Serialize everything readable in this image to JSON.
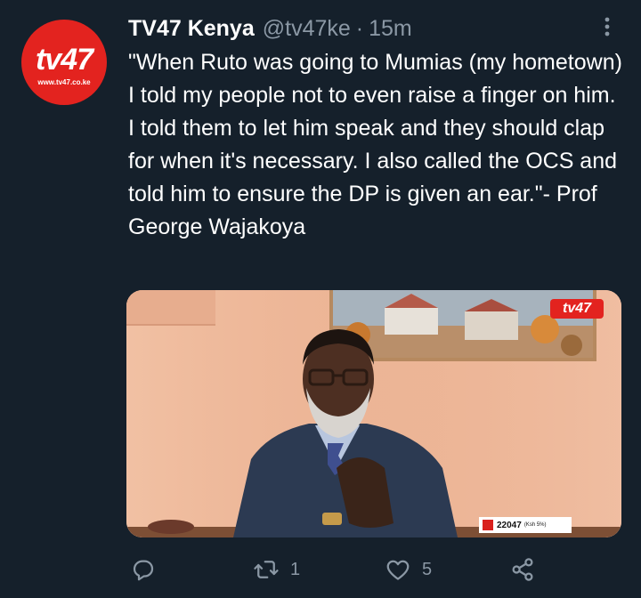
{
  "tweet": {
    "author": {
      "display_name": "TV47 Kenya",
      "handle": "@tv47ke",
      "separator": "·",
      "time": "15m",
      "avatar_logo": "tv47",
      "avatar_url_text": "www.tv47.co.ke"
    },
    "text": "\"When Ruto was going to Mumias (my hometown) I told my people not to even raise a finger on him. I told them to let him speak and they should clap for when it's necessary. I also called the OCS and told him to ensure the DP is given an ear.\"- Prof George Wajakoya",
    "media": {
      "brand_logo": "tv47",
      "ticker_value": "22047",
      "ticker_unit": "(Ksh 5%)"
    },
    "actions": {
      "reply_icon": "reply-icon",
      "retweet_icon": "retweet-icon",
      "retweet_count": "1",
      "like_icon": "heart-icon",
      "like_count": "5",
      "share_icon": "share-icon"
    },
    "colors": {
      "background": "#15202b",
      "secondary_text": "#8b98a5",
      "brand_red": "#e3231f"
    }
  }
}
